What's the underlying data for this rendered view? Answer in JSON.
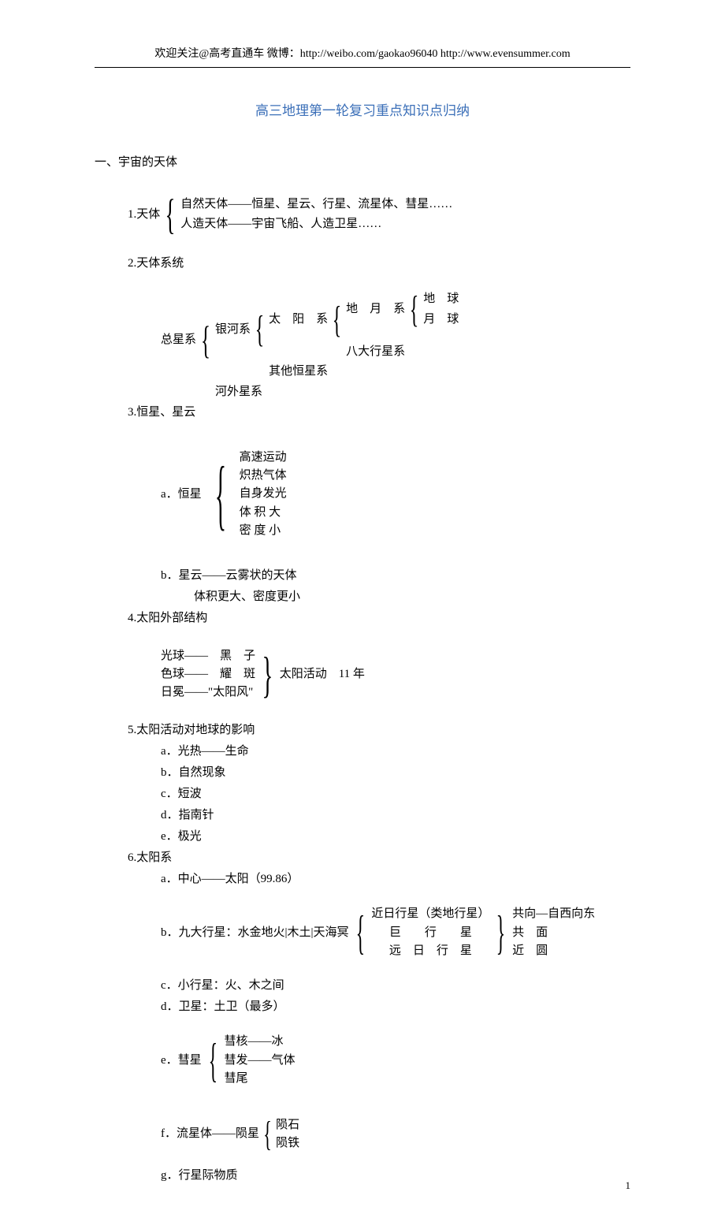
{
  "header": "欢迎关注@高考直通车  微博：http://weibo.com/gaokao96040    http://www.evensummer.com",
  "title": "高三地理第一轮复习重点知识点归纳",
  "section1": {
    "head": "一、宇宙的天体",
    "p1": {
      "label": "1.天体",
      "a": "自然天体——恒星、星云、行星、流星体、彗星……",
      "b": "人造天体——宇宙飞船、人造卫星……"
    },
    "p2": {
      "label": "2.天体系统",
      "root": "总星系",
      "l1a": "银河系",
      "l1b": "河外星系",
      "l2a": "太　阳　系",
      "l2b": "其他恒星系",
      "l3a": "地　月　系",
      "l3b": "八大行星系",
      "l4a": "地　球",
      "l4b": "月　球"
    },
    "p3": {
      "label": "3.恒星、星云",
      "a_label": "a．恒星",
      "a_items": [
        "高速运动",
        "炽热气体",
        "自身发光",
        "体 积 大",
        "密 度 小"
      ],
      "b_line1": "b．星云——云雾状的天体",
      "b_line2": "体积更大、密度更小"
    },
    "p4": {
      "label": "4.太阳外部结构",
      "rows": [
        "光球——　黑　子",
        "色球——　耀　斑",
        "日冕——\"太阳风\""
      ],
      "right": "太阳活动　11 年"
    },
    "p5": {
      "label": "5.太阳活动对地球的影响",
      "items": [
        "a．光热——生命",
        "b．自然现象",
        "c．短波",
        "d．指南针",
        "e．极光"
      ]
    },
    "p6": {
      "label": "6.太阳系",
      "a": "a．中心——太阳（99.86）",
      "b_label": "b．九大行星：水金地火|木土|天海冥",
      "b_mid": [
        "近日行星（类地行星）",
        "巨　　行　　星",
        "远　日　行　星"
      ],
      "b_right": [
        "共向—自西向东",
        "共　面",
        "近　圆"
      ],
      "c": "c．小行星：火、木之间",
      "d": "d．卫星：土卫（最多）",
      "e_label": "e．彗星",
      "e_items": [
        "彗核——冰",
        "彗发——气体",
        "彗尾"
      ],
      "f_label": "f．流星体——陨星",
      "f_items": [
        "陨石",
        "陨铁"
      ],
      "g": "g．行星际物质"
    }
  },
  "page_num": "1"
}
